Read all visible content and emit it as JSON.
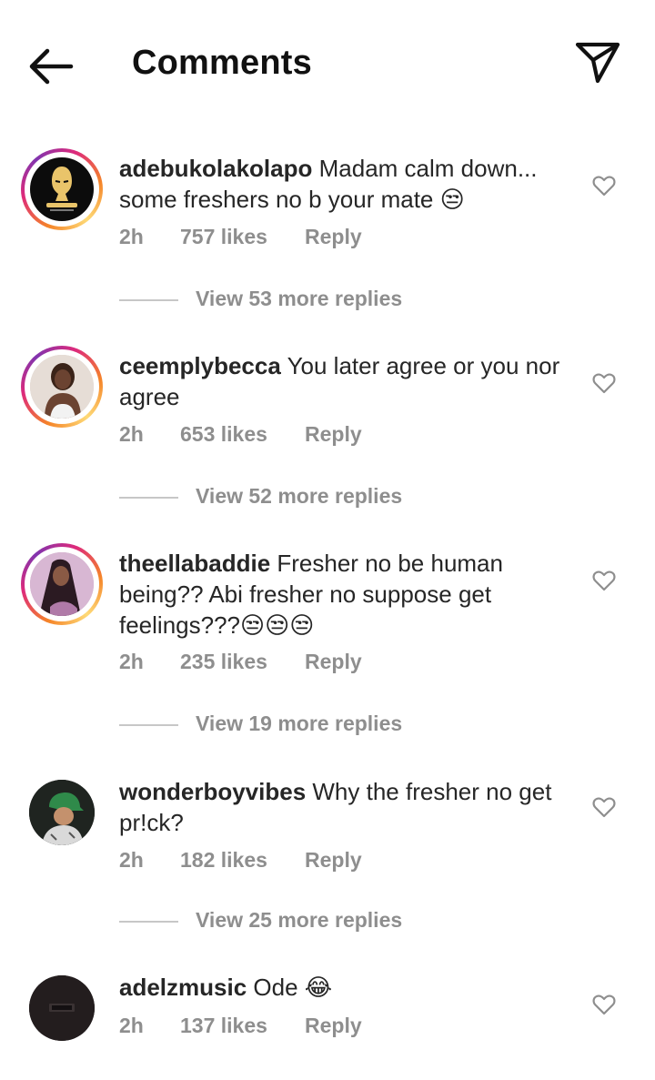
{
  "header": {
    "title": "Comments",
    "back_icon": "arrow-left-icon",
    "send_icon": "paper-plane-icon"
  },
  "colors": {
    "text": "#262626",
    "muted": "#8e8e8e",
    "story_ring_start": "#f58529",
    "story_ring_end": "#dd2a7b"
  },
  "comments": [
    {
      "username": "adebukolakolapo",
      "text": "Madam calm down... some freshers no b your mate",
      "emoji": "😒",
      "time": "2h",
      "likes": "757 likes",
      "reply": "Reply",
      "view_replies": "View 53 more replies",
      "story_ring": true
    },
    {
      "username": "ceemplybecca",
      "text": "You later agree or you nor agree",
      "emoji": "",
      "time": "2h",
      "likes": "653 likes",
      "reply": "Reply",
      "view_replies": "View 52 more replies",
      "story_ring": true
    },
    {
      "username": "theellabaddie",
      "text": "Fresher no be human being?? Abi fresher no suppose get feelings???",
      "emoji": "😒😒😒",
      "time": "2h",
      "likes": "235 likes",
      "reply": "Reply",
      "view_replies": "View 19 more replies",
      "story_ring": true
    },
    {
      "username": "wonderboyvibes",
      "text": "Why the fresher no get pr!ck?",
      "emoji": "",
      "time": "2h",
      "likes": "182 likes",
      "reply": "Reply",
      "view_replies": "View 25 more replies",
      "story_ring": false
    },
    {
      "username": "adelzmusic",
      "text": "Ode",
      "emoji": "😂",
      "time": "2h",
      "likes": "137 likes",
      "reply": "Reply",
      "view_replies": "",
      "story_ring": false
    }
  ]
}
